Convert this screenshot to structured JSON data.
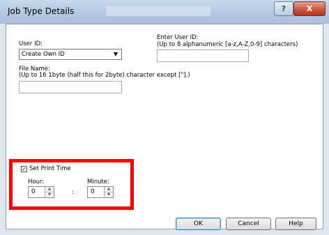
{
  "window": {
    "title": "Job Type Details",
    "help_label": "?",
    "close_label": "X"
  },
  "user_id": {
    "label": "User ID:",
    "selected": "Create Own ID",
    "enter_label": "Enter User ID:",
    "enter_hint": "(Up to 8 alphanumeric [a-z,A-Z,0-9] characters)",
    "enter_value": ""
  },
  "file_name": {
    "label": "File Name:",
    "hint": "(Up to 16 1byte (half this for 2byte) character except [\"].)",
    "value": ""
  },
  "print_time": {
    "checkbox_label": "Set Print Time",
    "checked": true,
    "check_mark": "✓",
    "hour_label": "Hour:",
    "hour_value": "0",
    "separator": ":",
    "minute_label": "Minute:",
    "minute_value": "0",
    "up_glyph": "▲",
    "down_glyph": "▼"
  },
  "buttons": {
    "ok": "OK",
    "cancel": "Cancel",
    "help": "Help"
  },
  "colors": {
    "highlight": "#ff0000"
  }
}
